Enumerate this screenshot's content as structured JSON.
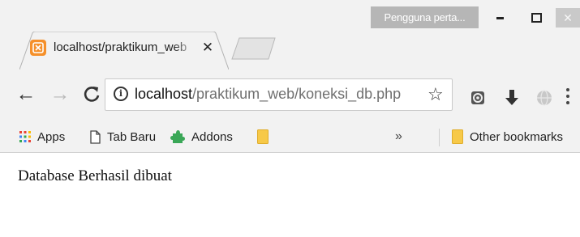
{
  "window": {
    "profile_label": "Pengguna perta...",
    "controls": [
      "minimize",
      "maximize",
      "close"
    ]
  },
  "tabs": [
    {
      "title": "localhost/praktikum_web",
      "favicon": "xampp-icon",
      "active": true
    }
  ],
  "toolbar": {
    "url_host": "localhost",
    "url_path": "/praktikum_web/koneksi_db.php",
    "icons": [
      "back-arrow-icon",
      "forward-arrow-icon",
      "reload-icon",
      "info-icon",
      "star-icon",
      "extension-icon",
      "download-arrow-icon",
      "globe-icon",
      "more-menu-icon"
    ]
  },
  "bookmarks": {
    "items": [
      {
        "label": "Apps",
        "icon": "apps-grid-icon"
      },
      {
        "label": "Tab Baru",
        "icon": "page-icon"
      },
      {
        "label": "Addons",
        "icon": "puzzle-icon"
      },
      {
        "label": "",
        "icon": "folder-icon"
      }
    ],
    "overflow": "»",
    "other_label": "Other bookmarks"
  },
  "page": {
    "message": "Database Berhasil dibuat"
  },
  "colors": {
    "chrome_bg": "#f2f2f2",
    "profile_bg": "#b6b6b6",
    "folder": "#f7c948",
    "favicon": "#f5902a",
    "puzzle": "#3aa757"
  }
}
